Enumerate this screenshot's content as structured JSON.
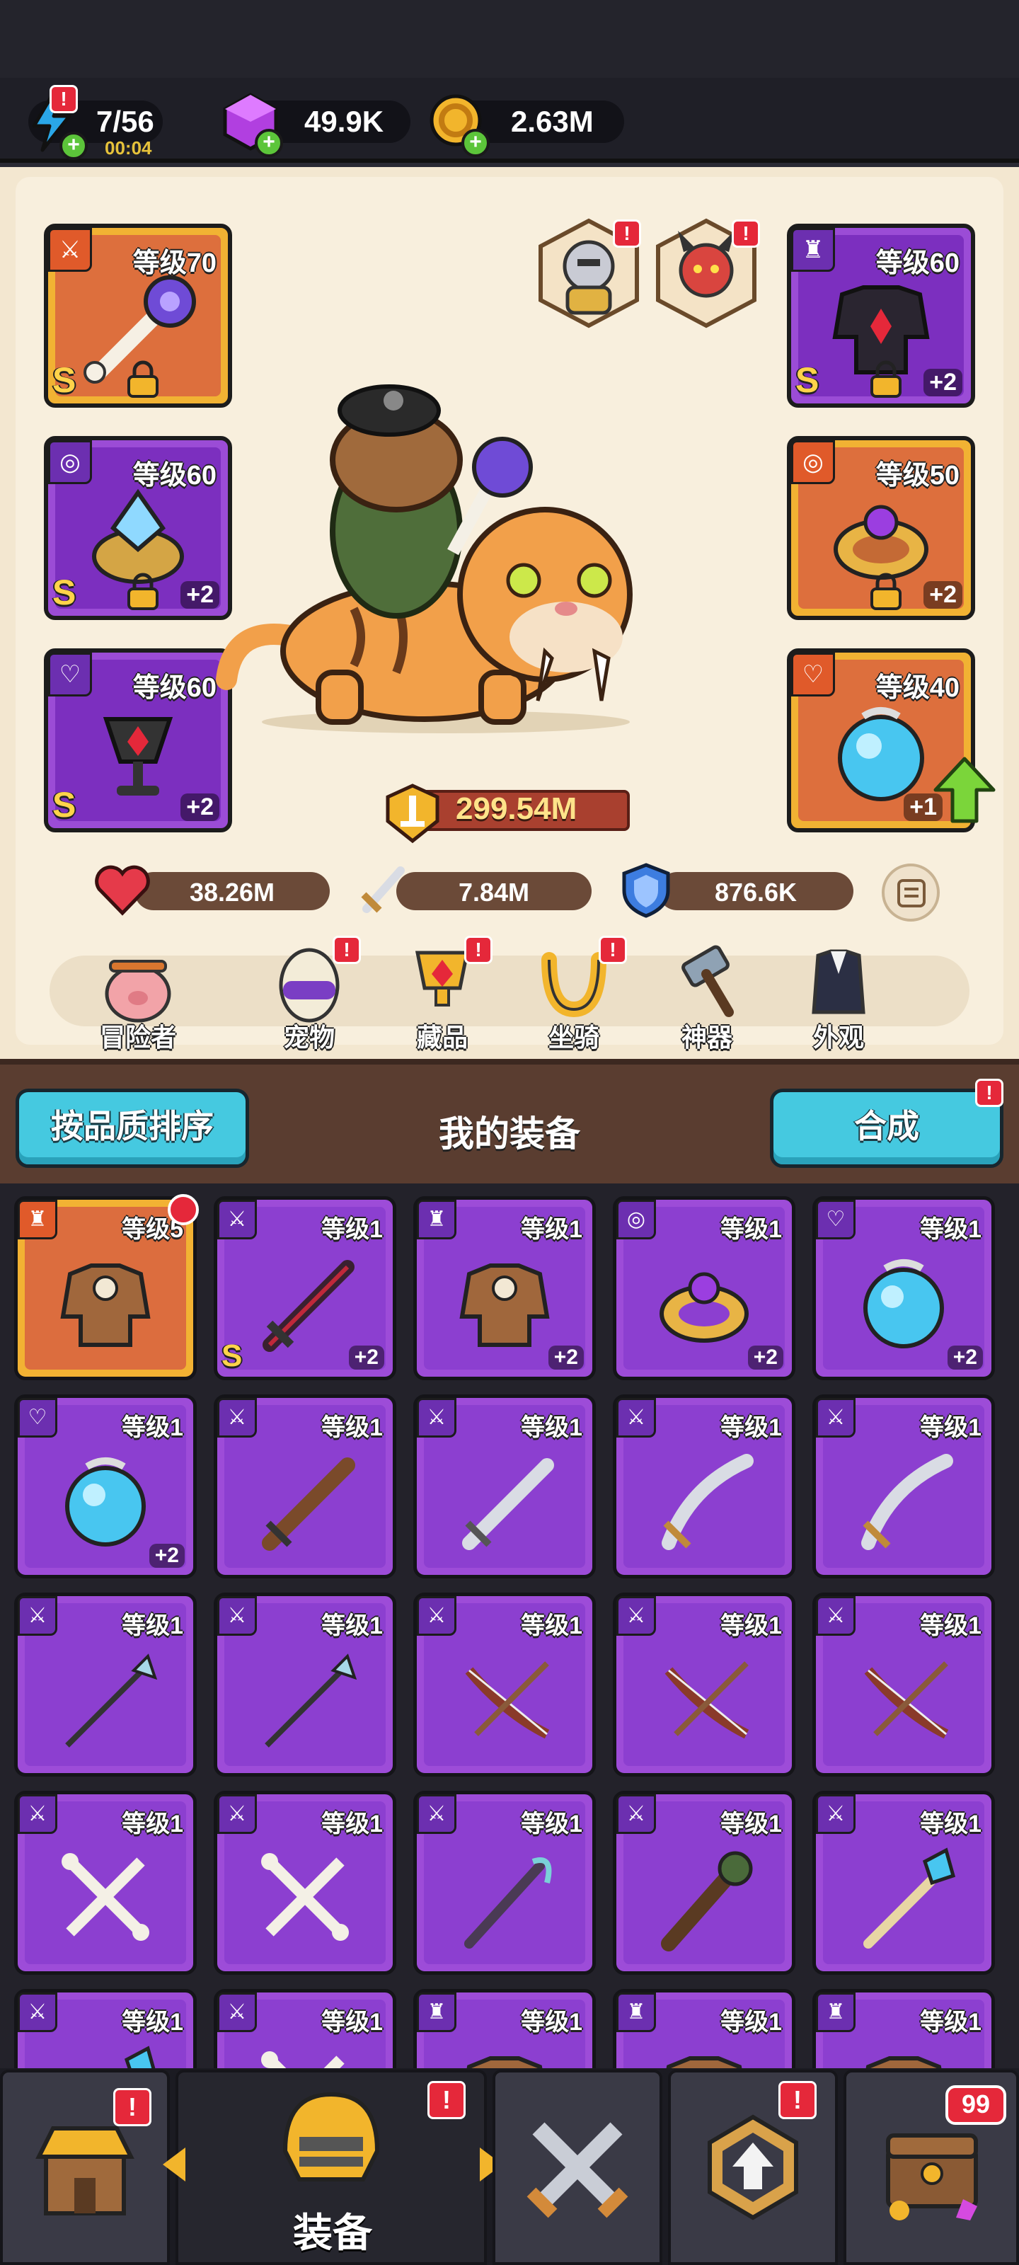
{
  "resources": {
    "energy": {
      "value": "7/56",
      "timer": "00:04",
      "icon": "lightning-icon"
    },
    "gems": {
      "value": "49.9K",
      "icon": "purple-gem-icon"
    },
    "gold": {
      "value": "2.63M",
      "icon": "gold-coin-icon"
    }
  },
  "equipped": {
    "left": [
      {
        "level": "等级70",
        "type": "sword",
        "rank": "S",
        "locked": true,
        "plus": ""
      },
      {
        "level": "等级60",
        "type": "ring",
        "rank": "S",
        "locked": true,
        "plus": "+2"
      },
      {
        "level": "等级60",
        "type": "necklace",
        "rank": "S",
        "locked": false,
        "plus": "+2"
      }
    ],
    "right": [
      {
        "level": "等级60",
        "type": "armor",
        "rank": "S",
        "locked": true,
        "plus": "+2"
      },
      {
        "level": "等级50",
        "type": "ring",
        "rank": "",
        "locked": true,
        "plus": "+2"
      },
      {
        "level": "等级40",
        "type": "necklace",
        "rank": "",
        "locked": false,
        "plus": "+1"
      }
    ]
  },
  "combat_power": "299.54M",
  "stats": {
    "hp": "38.26M",
    "attack": "7.84M",
    "defense": "876.6K"
  },
  "tabs": [
    {
      "label": "冒险者",
      "icon": "pig-adventurer-icon",
      "alert": false
    },
    {
      "label": "宠物",
      "icon": "egg-pet-icon",
      "alert": true
    },
    {
      "label": "藏品",
      "icon": "trophy-collection-icon",
      "alert": true
    },
    {
      "label": "坐骑",
      "icon": "horseshoe-mount-icon",
      "alert": true
    },
    {
      "label": "神器",
      "icon": "hammer-artifact-icon",
      "alert": false
    },
    {
      "label": "外观",
      "icon": "outfit-appearance-icon",
      "alert": false
    }
  ],
  "section": {
    "sort_label": "按品质排序",
    "title": "我的装备",
    "merge_label": "合成"
  },
  "inventory": [
    {
      "level": "等级5",
      "type": "armor",
      "color": "gold",
      "item": "fur-armor",
      "rank": "",
      "plus": "",
      "new": true
    },
    {
      "level": "等级1",
      "type": "sword",
      "color": "purple",
      "item": "dark-sword",
      "rank": "S",
      "plus": "+2",
      "new": false
    },
    {
      "level": "等级1",
      "type": "armor",
      "color": "purple",
      "item": "fur-armor",
      "rank": "",
      "plus": "+2",
      "new": false
    },
    {
      "level": "等级1",
      "type": "ring",
      "color": "purple",
      "item": "gold-ring",
      "rank": "",
      "plus": "+2",
      "new": false
    },
    {
      "level": "等级1",
      "type": "necklace",
      "color": "purple",
      "item": "blue-orb",
      "rank": "",
      "plus": "+2",
      "new": false
    },
    {
      "level": "等级1",
      "type": "necklace",
      "color": "purple",
      "item": "blue-orb",
      "rank": "",
      "plus": "+2",
      "new": false
    },
    {
      "level": "等级1",
      "type": "sword",
      "color": "purple",
      "item": "wood-sword",
      "rank": "",
      "plus": "",
      "new": false
    },
    {
      "level": "等级1",
      "type": "sword",
      "color": "purple",
      "item": "steel-sword",
      "rank": "",
      "plus": "",
      "new": false
    },
    {
      "level": "等级1",
      "type": "sword",
      "color": "purple",
      "item": "scimitar",
      "rank": "",
      "plus": "",
      "new": false
    },
    {
      "level": "等级1",
      "type": "sword",
      "color": "purple",
      "item": "scimitar",
      "rank": "",
      "plus": "",
      "new": false
    },
    {
      "level": "等级1",
      "type": "sword",
      "color": "purple",
      "item": "spear",
      "rank": "",
      "plus": "",
      "new": false
    },
    {
      "level": "等级1",
      "type": "sword",
      "color": "purple",
      "item": "spear",
      "rank": "",
      "plus": "",
      "new": false
    },
    {
      "level": "等级1",
      "type": "sword",
      "color": "purple",
      "item": "bow",
      "rank": "",
      "plus": "",
      "new": false
    },
    {
      "level": "等级1",
      "type": "sword",
      "color": "purple",
      "item": "bow",
      "rank": "",
      "plus": "",
      "new": false
    },
    {
      "level": "等级1",
      "type": "sword",
      "color": "purple",
      "item": "bow",
      "rank": "",
      "plus": "",
      "new": false
    },
    {
      "level": "等级1",
      "type": "sword",
      "color": "purple",
      "item": "bone-bow",
      "rank": "",
      "plus": "",
      "new": false
    },
    {
      "level": "等级1",
      "type": "sword",
      "color": "purple",
      "item": "bone-bow",
      "rank": "",
      "plus": "",
      "new": false
    },
    {
      "level": "等级1",
      "type": "sword",
      "color": "purple",
      "item": "staff",
      "rank": "",
      "plus": "",
      "new": false
    },
    {
      "level": "等级1",
      "type": "sword",
      "color": "purple",
      "item": "club",
      "rank": "",
      "plus": "",
      "new": false
    },
    {
      "level": "等级1",
      "type": "sword",
      "color": "purple",
      "item": "crystal-wand",
      "rank": "",
      "plus": "",
      "new": false
    },
    {
      "level": "等级1",
      "type": "sword",
      "color": "purple",
      "item": "crystal-wand",
      "rank": "",
      "plus": "",
      "new": false
    },
    {
      "level": "等级1",
      "type": "sword",
      "color": "purple",
      "item": "bone-bow",
      "rank": "",
      "plus": "",
      "new": false
    },
    {
      "level": "等级1",
      "type": "armor",
      "color": "purple",
      "item": "fur-armor",
      "rank": "",
      "plus": "",
      "new": false
    },
    {
      "level": "等级1",
      "type": "armor",
      "color": "purple",
      "item": "fur-armor",
      "rank": "",
      "plus": "",
      "new": false
    },
    {
      "level": "等级1",
      "type": "armor",
      "color": "purple",
      "item": "fur-armor",
      "rank": "",
      "plus": "",
      "new": false
    }
  ],
  "bottom_nav": {
    "active_label": "装备",
    "chest_count": "99",
    "tabs": [
      {
        "icon": "shop-icon",
        "alert": true
      },
      {
        "icon": "helmet-equipment-icon",
        "alert": true
      },
      {
        "icon": "crossed-swords-icon",
        "alert": false
      },
      {
        "icon": "upgrade-emblem-icon",
        "alert": true
      },
      {
        "icon": "treasure-chest-icon",
        "alert": false
      }
    ]
  },
  "colors": {
    "gold_frame": "#f1b233",
    "purple_frame": "#9b4cd6",
    "accent_cyan": "#45c9e0",
    "alert_red": "#e5283a"
  }
}
